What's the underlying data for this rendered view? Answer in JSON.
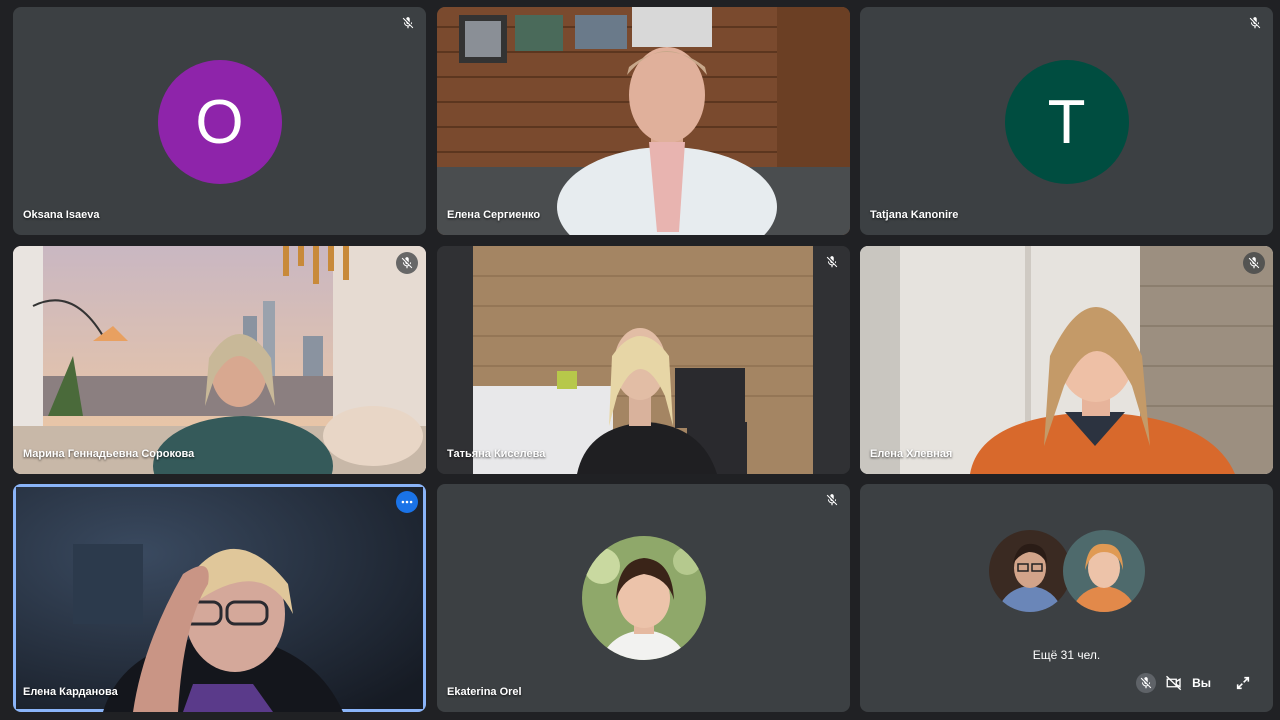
{
  "participants": [
    {
      "name": "Oksana Isaeva",
      "initial": "O",
      "avatar_color": "#8e24aa",
      "muted": true
    },
    {
      "name": "Елена Сергиенко",
      "muted": false
    },
    {
      "name": "Tatjana Kanonire",
      "initial": "T",
      "avatar_color": "#004d40",
      "muted": true
    },
    {
      "name": "Марина Геннадьевна Сорокова",
      "muted": true
    },
    {
      "name": "Татьяна Киселева",
      "muted": true
    },
    {
      "name": "Елена Хлевная",
      "muted": true
    },
    {
      "name": "Елена Карданова",
      "muted": false,
      "active_speaker": true
    },
    {
      "name": "Ekaterina Orel",
      "muted": true
    }
  ],
  "overflow": {
    "label": "Ещё 31 чел."
  },
  "self_view": {
    "label": "Вы"
  },
  "colors": {
    "background": "#202124",
    "tile": "#3c4043",
    "accent": "#8ab4f8",
    "more_button": "#1a73e8"
  }
}
